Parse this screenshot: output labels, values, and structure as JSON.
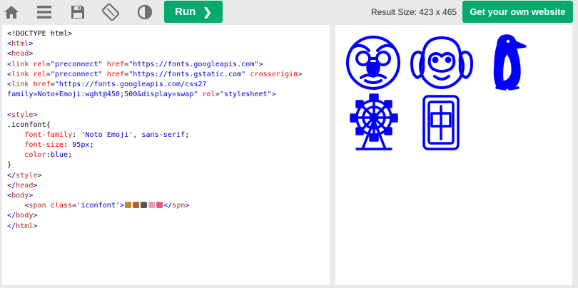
{
  "toolbar": {
    "icons": [
      "home-icon",
      "menu-icon",
      "save-icon",
      "rotate-icon",
      "theme-contrast-icon"
    ],
    "run_label": "Run",
    "run_chevron": "❯",
    "result_size": "Result Size: 423 x 465",
    "get_website_label": "Get your own website"
  },
  "editor": {
    "lines": [
      [
        {
          "c": "t-txt",
          "t": "<!DOCTYPE html>"
        }
      ],
      [
        {
          "c": "t-angle",
          "t": "<"
        },
        {
          "c": "t-tag",
          "t": "html"
        },
        {
          "c": "t-angle",
          "t": ">"
        }
      ],
      [
        {
          "c": "t-angle",
          "t": "<"
        },
        {
          "c": "t-tag",
          "t": "head"
        },
        {
          "c": "t-angle",
          "t": ">"
        }
      ],
      [
        {
          "c": "t-angle",
          "t": "<"
        },
        {
          "c": "t-tag",
          "t": "link"
        },
        {
          "c": "t-attr",
          "t": " rel"
        },
        {
          "c": "t-txt",
          "t": "="
        },
        {
          "c": "t-val",
          "t": "\"preconnect\""
        },
        {
          "c": "t-attr",
          "t": " href"
        },
        {
          "c": "t-txt",
          "t": "="
        },
        {
          "c": "t-val",
          "t": "\"https://fonts.googleapis.com\""
        },
        {
          "c": "t-angle",
          "t": ">"
        }
      ],
      [
        {
          "c": "t-angle",
          "t": "<"
        },
        {
          "c": "t-tag",
          "t": "link"
        },
        {
          "c": "t-attr",
          "t": " rel"
        },
        {
          "c": "t-txt",
          "t": "="
        },
        {
          "c": "t-val",
          "t": "\"preconnect\""
        },
        {
          "c": "t-attr",
          "t": " href"
        },
        {
          "c": "t-txt",
          "t": "="
        },
        {
          "c": "t-val",
          "t": "\"https://fonts.gstatic.com\""
        },
        {
          "c": "t-attr",
          "t": " crossorigin"
        },
        {
          "c": "t-angle",
          "t": ">"
        }
      ],
      [
        {
          "c": "t-angle",
          "t": "<"
        },
        {
          "c": "t-tag",
          "t": "link"
        },
        {
          "c": "t-attr",
          "t": " href"
        },
        {
          "c": "t-txt",
          "t": "="
        },
        {
          "c": "t-val",
          "t": "\"https://fonts.googleapis.com/css2?"
        }
      ],
      [
        {
          "c": "t-val",
          "t": "family=Noto+Emoji:wght@450;500&display=swap\""
        },
        {
          "c": "t-attr",
          "t": " rel"
        },
        {
          "c": "t-txt",
          "t": "="
        },
        {
          "c": "t-val",
          "t": "\"stylesheet\""
        },
        {
          "c": "t-angle",
          "t": ">"
        }
      ],
      [],
      [
        {
          "c": "t-angle",
          "t": "<"
        },
        {
          "c": "t-tag",
          "t": "style"
        },
        {
          "c": "t-angle",
          "t": ">"
        }
      ],
      [
        {
          "c": "t-txt",
          "t": ".iconfont{"
        }
      ],
      [
        {
          "c": "t-txt",
          "t": "    "
        },
        {
          "c": "t-prop",
          "t": "font-family"
        },
        {
          "c": "t-txt",
          "t": ": "
        },
        {
          "c": "t-pval",
          "t": "'Noto Emoji', sans-serif"
        },
        {
          "c": "t-txt",
          "t": ";"
        }
      ],
      [
        {
          "c": "t-txt",
          "t": "    "
        },
        {
          "c": "t-prop",
          "t": "font-size"
        },
        {
          "c": "t-txt",
          "t": ": "
        },
        {
          "c": "t-pval",
          "t": "95px"
        },
        {
          "c": "t-txt",
          "t": ";"
        }
      ],
      [
        {
          "c": "t-txt",
          "t": "    "
        },
        {
          "c": "t-prop",
          "t": "color"
        },
        {
          "c": "t-txt",
          "t": ":"
        },
        {
          "c": "t-pval",
          "t": "blue"
        },
        {
          "c": "t-txt",
          "t": ";"
        }
      ],
      [
        {
          "c": "t-txt",
          "t": "}"
        }
      ],
      [
        {
          "c": "t-angle",
          "t": "</"
        },
        {
          "c": "t-tag",
          "t": "style"
        },
        {
          "c": "t-angle",
          "t": ">"
        }
      ],
      [
        {
          "c": "t-angle",
          "t": "</"
        },
        {
          "c": "t-tag",
          "t": "head"
        },
        {
          "c": "t-angle",
          "t": ">"
        }
      ],
      [
        {
          "c": "t-angle",
          "t": "<"
        },
        {
          "c": "t-tag",
          "t": "body"
        },
        {
          "c": "t-angle",
          "t": ">"
        }
      ],
      [
        {
          "c": "t-txt",
          "t": "    "
        },
        {
          "c": "t-angle",
          "t": "<"
        },
        {
          "c": "t-tag",
          "t": "span"
        },
        {
          "c": "t-attr",
          "t": " class"
        },
        {
          "c": "t-txt",
          "t": "="
        },
        {
          "c": "t-val",
          "t": "'iconfont'"
        },
        {
          "c": "t-angle",
          "t": ">"
        },
        {
          "c": "emoji",
          "t": ""
        },
        {
          "c": "t-angle",
          "t": "</"
        },
        {
          "c": "t-tag",
          "t": "spn"
        },
        {
          "c": "t-angle",
          "t": ">"
        }
      ],
      [
        {
          "c": "t-angle",
          "t": "</"
        },
        {
          "c": "t-tag",
          "t": "body"
        },
        {
          "c": "t-angle",
          "t": ">"
        }
      ],
      [
        {
          "c": "t-angle",
          "t": "</"
        },
        {
          "c": "t-tag",
          "t": "html"
        },
        {
          "c": "t-angle",
          "t": ">"
        }
      ]
    ],
    "inline_emoji_colors": [
      "#c8842c",
      "#b0642a",
      "#555555",
      "#e8a0b0",
      "#e05a8a"
    ]
  },
  "result": {
    "emoji_color": "#0000ff",
    "emojis": [
      "disguised-face-icon",
      "hear-no-evil-monkey-icon",
      "penguin-icon",
      "ferris-wheel-icon",
      "mahjong-red-dragon-icon"
    ]
  },
  "colors": {
    "accent": "#04aa6d",
    "toolbar_bg": "#e7e9eb",
    "icon_gray": "#707070"
  }
}
